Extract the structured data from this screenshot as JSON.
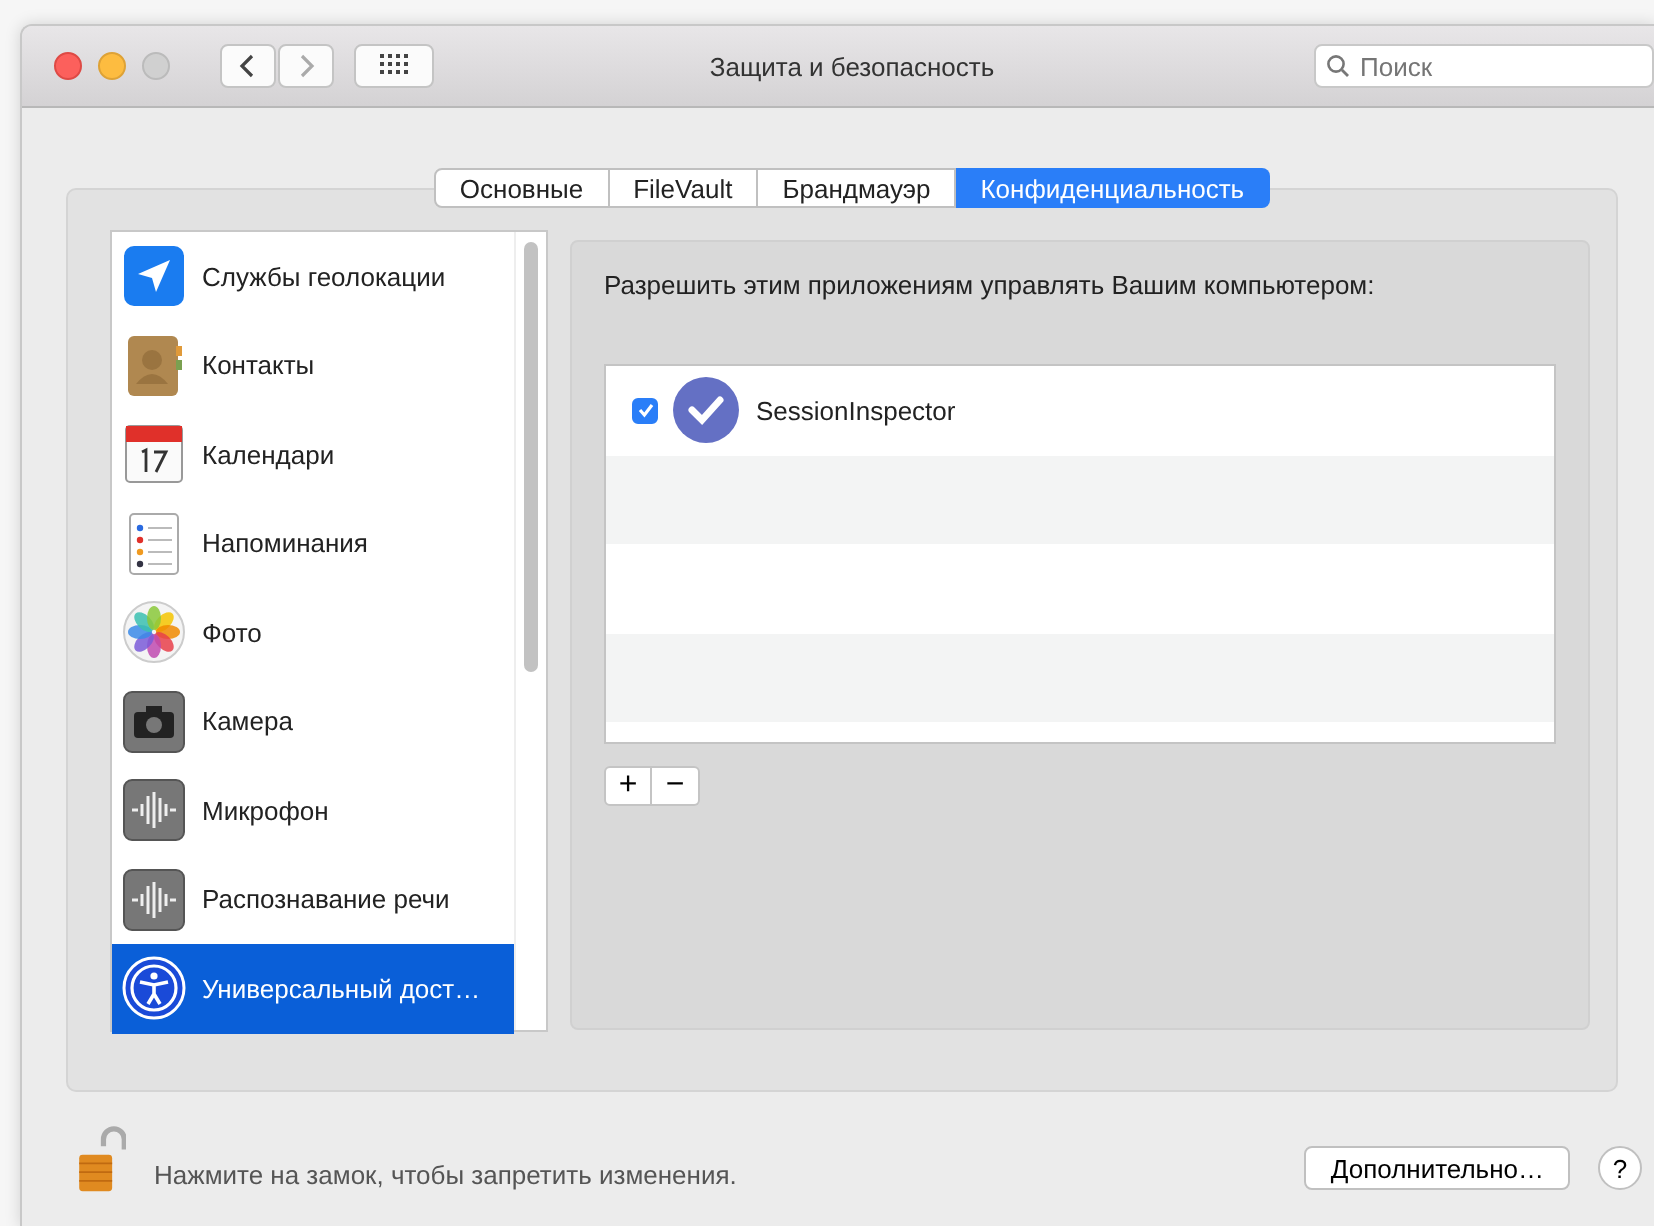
{
  "window": {
    "title": "Защита и безопасность"
  },
  "search": {
    "placeholder": "Поиск"
  },
  "tabs": [
    {
      "label": "Основные",
      "selected": false
    },
    {
      "label": "FileVault",
      "selected": false
    },
    {
      "label": "Брандмауэр",
      "selected": false
    },
    {
      "label": "Конфиденциальность",
      "selected": true
    }
  ],
  "sidebar": {
    "items": [
      {
        "label": "Службы геолокации",
        "selected": false
      },
      {
        "label": "Контакты",
        "selected": false
      },
      {
        "label": "Календари",
        "selected": false
      },
      {
        "label": "Напоминания",
        "selected": false
      },
      {
        "label": "Фото",
        "selected": false
      },
      {
        "label": "Камера",
        "selected": false
      },
      {
        "label": "Микрофон",
        "selected": false
      },
      {
        "label": "Распознавание речи",
        "selected": false
      },
      {
        "label": "Универсальный дост…",
        "selected": true
      }
    ]
  },
  "panel": {
    "heading": "Разрешить этим приложениям управлять Вашим компьютером:",
    "apps": [
      {
        "name": "SessionInspector",
        "checked": true
      }
    ],
    "add_button": "+",
    "remove_button": "−"
  },
  "footer": {
    "lock": {
      "locked": false
    },
    "lock_text": "Нажмите на замок, чтобы запретить изменения.",
    "advanced_button": "Дополнительно…",
    "help_button": "?"
  }
}
